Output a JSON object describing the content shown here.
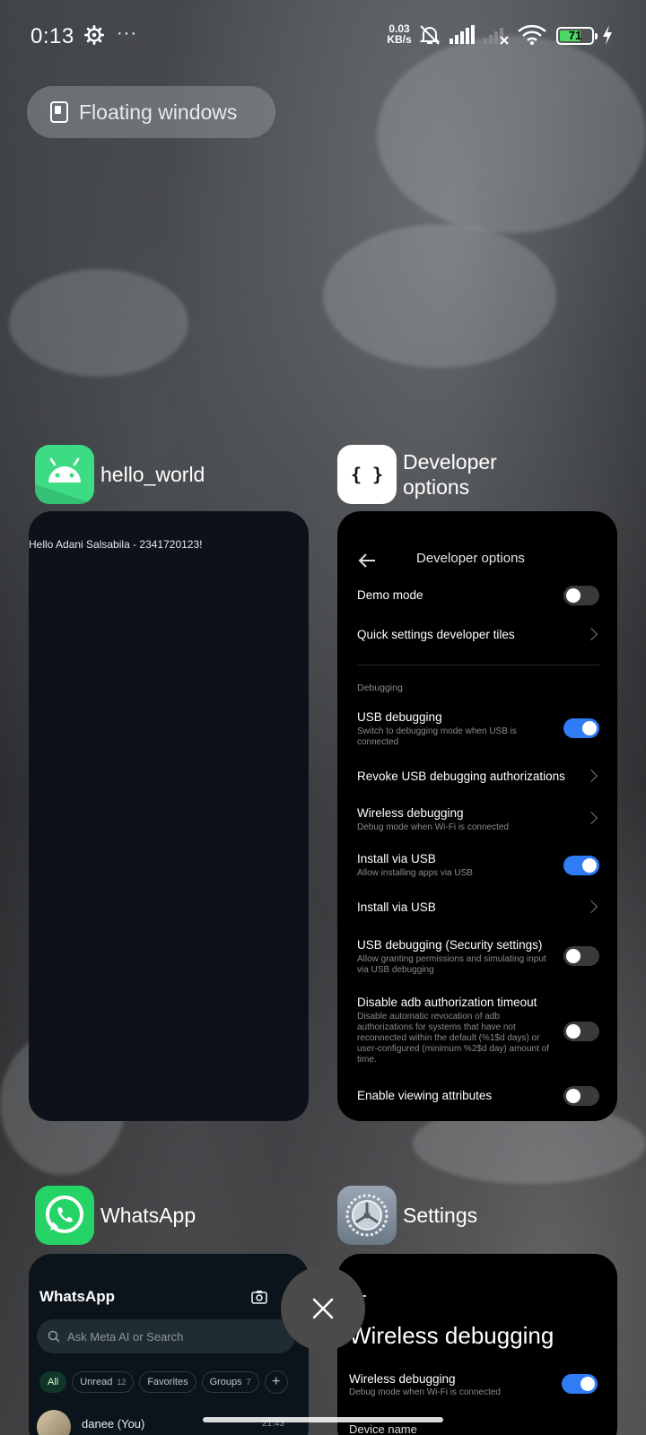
{
  "status_bar": {
    "time": "0:13",
    "more": "···",
    "speed_value": "0.03",
    "speed_unit": "KB/s",
    "battery": "71",
    "battery_level": 0.71,
    "icons": [
      "gear-icon",
      "mute-icon",
      "signal-icon",
      "signal-off-icon",
      "wifi-icon",
      "battery-icon",
      "charging-icon"
    ]
  },
  "floating_windows": {
    "label": "Floating windows"
  },
  "apps": {
    "hello_world": {
      "name": "hello_world",
      "content": "Hello Adani Salsabila - 2341720123!"
    },
    "developer_options": {
      "name_line1": "Developer",
      "name_line2": "options",
      "title": "Developer options",
      "rows": {
        "demo_mode": {
          "title": "Demo mode",
          "on": false
        },
        "quick_tiles": {
          "title": "Quick settings developer tiles"
        },
        "section": "Debugging",
        "usb_debugging": {
          "title": "USB debugging",
          "sub": "Switch to debugging mode when USB is connected",
          "on": true
        },
        "revoke": {
          "title": "Revoke USB debugging authorizations"
        },
        "wireless": {
          "title": "Wireless debugging",
          "sub": "Debug mode when Wi-Fi is connected"
        },
        "install_usb_toggle": {
          "title": "Install via USB",
          "sub": "Allow installing apps via USB",
          "on": true
        },
        "install_usb": {
          "title": "Install via USB"
        },
        "usb_security": {
          "title": "USB debugging (Security settings)",
          "sub": "Allow granting permissions and simulating input via USB debugging",
          "on": false
        },
        "adb_timeout": {
          "title": "Disable adb authorization timeout",
          "sub": "Disable automatic revocation of adb authorizations for systems that have not reconnected within the default (%1$d days) or user-configured (minimum %2$d day) amount of time.",
          "on": false
        },
        "view_attrs": {
          "title": "Enable viewing attributes",
          "on": false
        }
      }
    },
    "whatsapp": {
      "name": "WhatsApp",
      "title": "WhatsApp",
      "search_placeholder": "Ask Meta AI or Search",
      "chips": {
        "all": "All",
        "unread": "Unread",
        "unread_count": "12",
        "favorites": "Favorites",
        "groups": "Groups",
        "groups_count": "7",
        "add": "+"
      },
      "chat": {
        "name": "danee (You)",
        "time": "21:43"
      }
    },
    "settings": {
      "name": "Settings",
      "title": "Wireless debugging",
      "row_title": "Wireless debugging",
      "row_sub": "Debug mode when Wi-Fi is connected",
      "row_on": true,
      "next_row": "Device name"
    }
  },
  "colors": {
    "toggle_on": "#2f7cf6",
    "toggle_off": "#3a3a3a",
    "android_green": "#3ddc84",
    "whatsapp_green": "#25d366"
  }
}
